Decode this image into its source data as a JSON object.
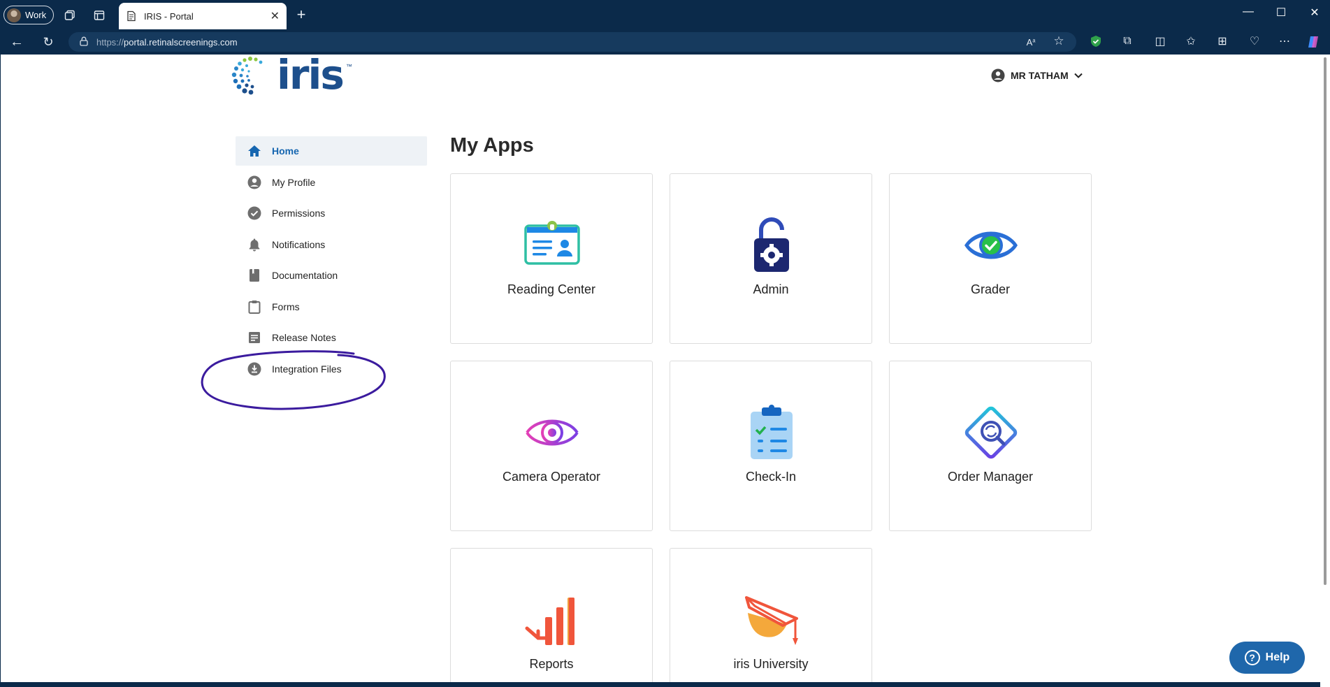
{
  "browser": {
    "profile_label": "Work",
    "tab_title": "IRIS - Portal",
    "url_protocol": "https://",
    "url_host": "portal.retinalscreenings.com"
  },
  "header": {
    "logo_text": "iris",
    "logo_tm": "™",
    "user_name": "MR TATHAM"
  },
  "sidebar": {
    "items": [
      {
        "label": "Home",
        "icon": "home-icon",
        "active": true
      },
      {
        "label": "My Profile",
        "icon": "account-circle-icon"
      },
      {
        "label": "Permissions",
        "icon": "check-circle-icon"
      },
      {
        "label": "Notifications",
        "icon": "bell-icon"
      },
      {
        "label": "Documentation",
        "icon": "book-icon"
      },
      {
        "label": "Forms",
        "icon": "clipboard-icon"
      },
      {
        "label": "Release Notes",
        "icon": "notes-icon"
      },
      {
        "label": "Integration Files",
        "icon": "download-circle-icon"
      }
    ]
  },
  "main": {
    "title": "My Apps",
    "apps": [
      {
        "label": "Reading Center",
        "icon": "id-badge-icon"
      },
      {
        "label": "Admin",
        "icon": "unlocked-padlock-gear-icon"
      },
      {
        "label": "Grader",
        "icon": "eye-check-icon"
      },
      {
        "label": "Camera Operator",
        "icon": "eye-scan-icon"
      },
      {
        "label": "Check-In",
        "icon": "clipboard-check-icon"
      },
      {
        "label": "Order Manager",
        "icon": "tablet-search-icon"
      },
      {
        "label": "Reports",
        "icon": "bar-chart-icon"
      },
      {
        "label": "iris University",
        "icon": "graduation-cap-icon"
      }
    ]
  },
  "help": {
    "label": "Help"
  },
  "colors": {
    "brand_blue": "#1d4f8c",
    "active_nav_text": "#1666b0",
    "help_button": "#1f67ab",
    "annotation_ink": "#3b1b9e"
  }
}
